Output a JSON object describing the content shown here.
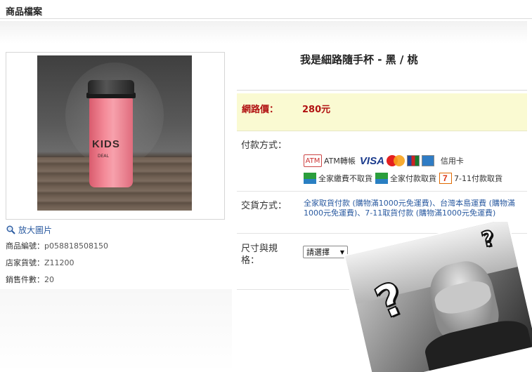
{
  "header": {
    "title": "商品檔案"
  },
  "product": {
    "name": "我是細路隨手杯 - 黑 / 桃",
    "image_text": "KIDS",
    "image_subtext": "DEAL"
  },
  "left": {
    "enlarge_label": "放大圖片",
    "meta": [
      {
        "label": "商品編號：",
        "value": "p058818508150"
      },
      {
        "label": "店家貨號：",
        "value": "Z11200"
      },
      {
        "label": "銷售件數：",
        "value": "20"
      }
    ]
  },
  "price": {
    "label": "網路價：",
    "value": "280元"
  },
  "payment": {
    "label": "付款方式：",
    "atm_icon": "ATM",
    "atm": "ATM轉帳",
    "visa": "VISA",
    "credit": "信用卡",
    "family_cod": "全家繳費不取貨",
    "family_pickup": "全家付款取貨",
    "seven_pickup": "7-11付款取貨"
  },
  "shipping": {
    "label": "交貨方式：",
    "text": "全家取貨付款 (購物滿1000元免運費)、台灣本島運費 (購物滿1000元免運費)、7-11取貨付款 (購物滿1000元免運費)"
  },
  "size": {
    "label_line1": "尺寸與規",
    "label_line2": "格：",
    "selected": "請選擇",
    "arrow": "▼"
  },
  "meme": {
    "mark": "?"
  },
  "colors": {
    "price_red": "#b11212",
    "link_blue": "#2a5aa0",
    "price_band": "#fafad2"
  }
}
